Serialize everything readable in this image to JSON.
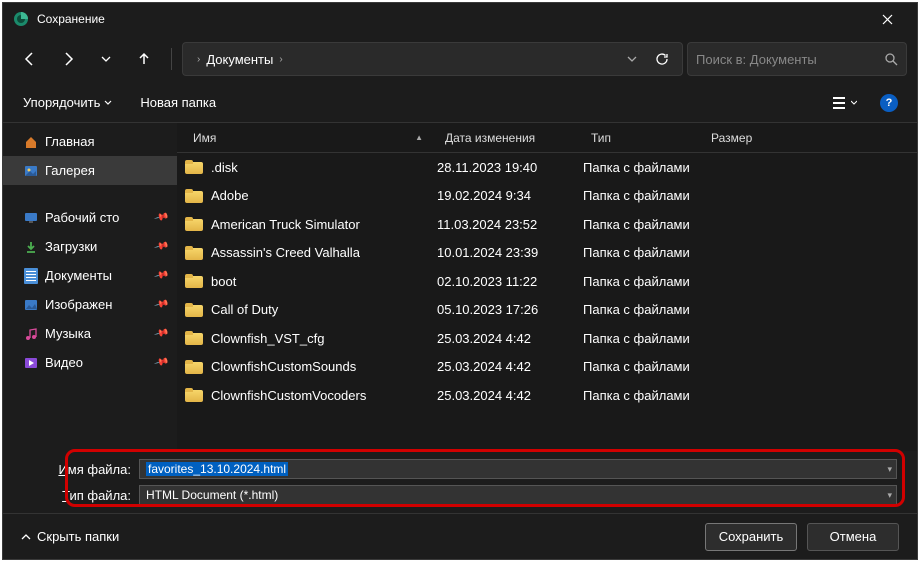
{
  "titlebar": {
    "title": "Сохранение"
  },
  "nav": {
    "crumb1": "Документы",
    "search_placeholder": "Поиск в: Документы"
  },
  "organize": {
    "organize": "Упорядочить",
    "new_folder": "Новая папка"
  },
  "sidebar": {
    "home": "Главная",
    "gallery": "Галерея",
    "desktop": "Рабочий сто",
    "downloads": "Загрузки",
    "documents": "Документы",
    "pictures": "Изображен",
    "music": "Музыка",
    "videos": "Видео"
  },
  "columns": {
    "name": "Имя",
    "date": "Дата изменения",
    "type": "Тип",
    "size": "Размер"
  },
  "type_folder": "Папка с файлами",
  "files": [
    {
      "name": ".disk",
      "date": "28.11.2023 19:40"
    },
    {
      "name": "Adobe",
      "date": "19.02.2024 9:34"
    },
    {
      "name": "American Truck Simulator",
      "date": "11.03.2024 23:52"
    },
    {
      "name": "Assassin's Creed Valhalla",
      "date": "10.01.2024 23:39"
    },
    {
      "name": "boot",
      "date": "02.10.2023 11:22"
    },
    {
      "name": "Call of Duty",
      "date": "05.10.2023 17:26"
    },
    {
      "name": "Clownfish_VST_cfg",
      "date": "25.03.2024 4:42"
    },
    {
      "name": "ClownfishCustomSounds",
      "date": "25.03.2024 4:42"
    },
    {
      "name": "ClownfishCustomVocoders",
      "date": "25.03.2024 4:42"
    }
  ],
  "form": {
    "filename_label_pre": "",
    "filename_label_u": "И",
    "filename_label_post": "мя файла:",
    "filetype_label_pre": "",
    "filetype_label_u": "Т",
    "filetype_label_post": "ип файла:",
    "filename_value": "favorites_13.10.2024.html",
    "filetype_value": "HTML Document (*.html)"
  },
  "footer": {
    "hide": "Скрыть папки",
    "save": "Сохранить",
    "cancel": "Отмена"
  }
}
